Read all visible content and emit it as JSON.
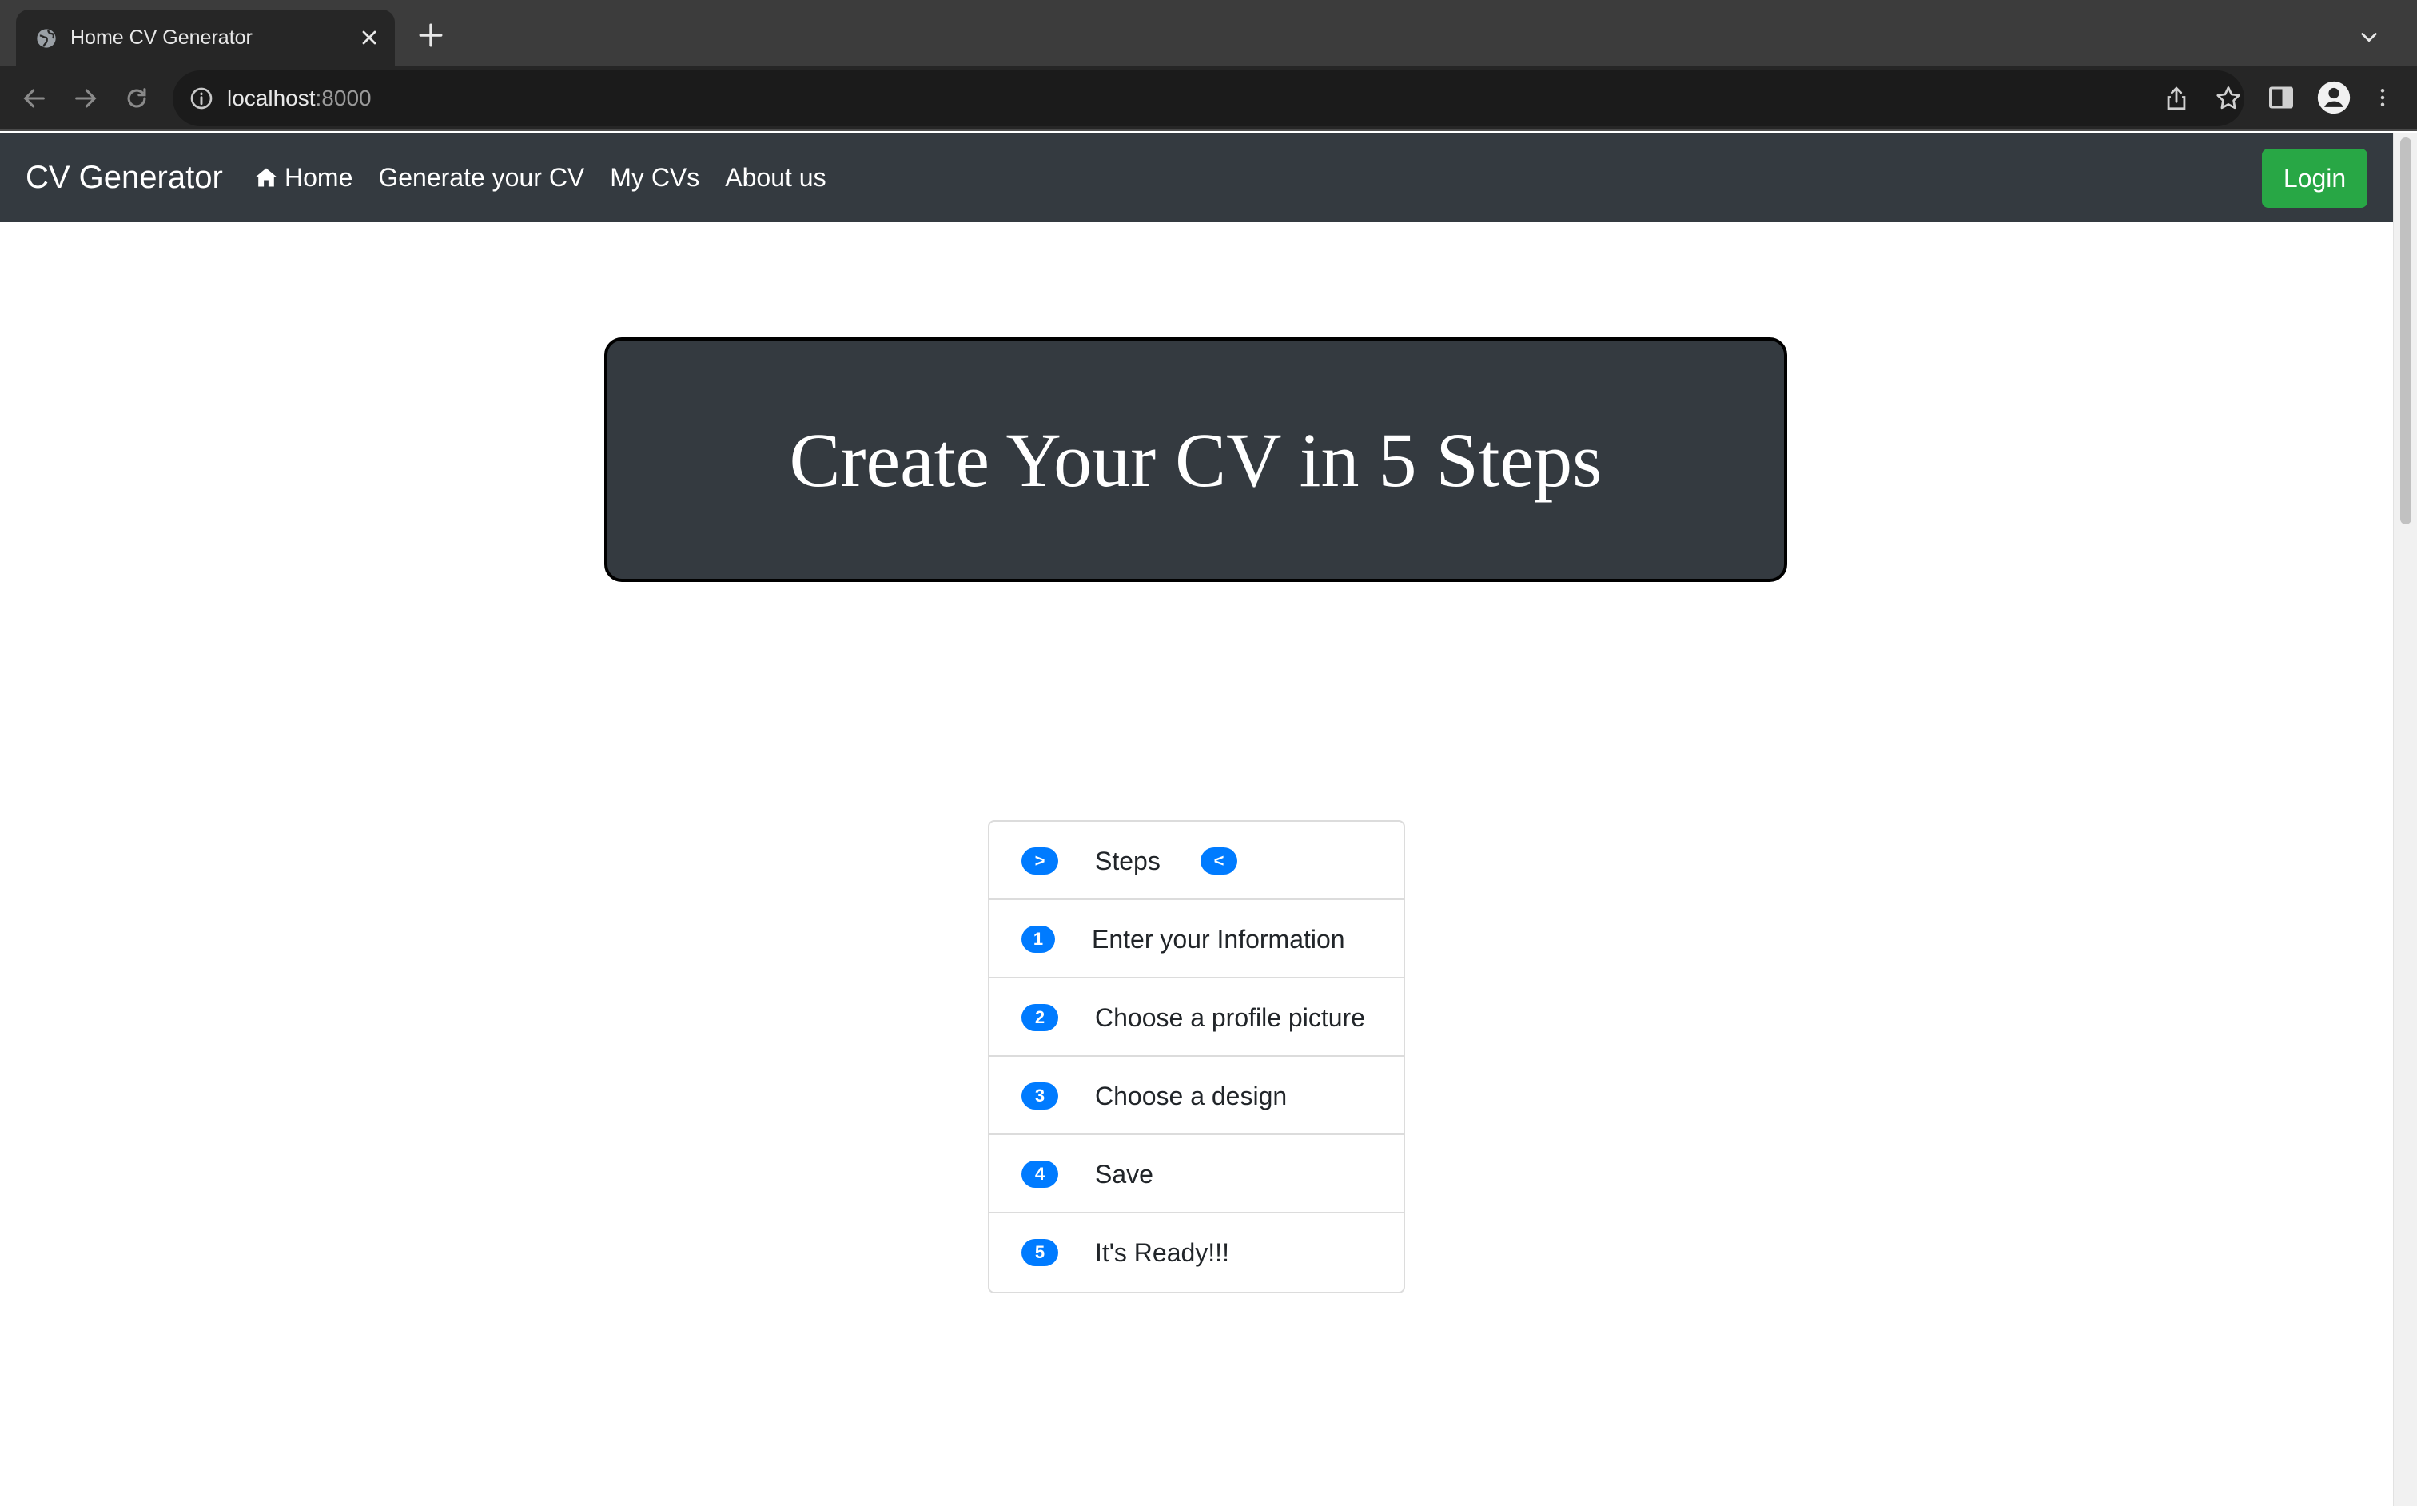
{
  "browser": {
    "tab_title": "Home CV Generator",
    "url_host": "localhost",
    "url_port": ":8000"
  },
  "navbar": {
    "brand": "CV Generator",
    "links": [
      "Home",
      "Generate your CV",
      "My CVs",
      "About us"
    ],
    "login_label": "Login"
  },
  "hero": {
    "title": "Create Your CV in 5 Steps"
  },
  "steps": {
    "header": {
      "left_badge": ">",
      "label": "Steps",
      "right_badge": "<"
    },
    "items": [
      {
        "number": "1",
        "label": "Enter your Information"
      },
      {
        "number": "2",
        "label": "Choose a profile picture"
      },
      {
        "number": "3",
        "label": "Choose a design"
      },
      {
        "number": "4",
        "label": "Save"
      },
      {
        "number": "5",
        "label": "It's Ready!!!"
      }
    ]
  },
  "colors": {
    "navbar_bg": "#343a40",
    "login_green": "#28a745",
    "badge_blue": "#007bff",
    "hero_bg": "#343a40"
  },
  "icons": {
    "tab_favicon": "globe-icon",
    "home": "home-icon",
    "site_info": "info-icon",
    "share": "share-icon",
    "bookmark": "star-icon"
  }
}
